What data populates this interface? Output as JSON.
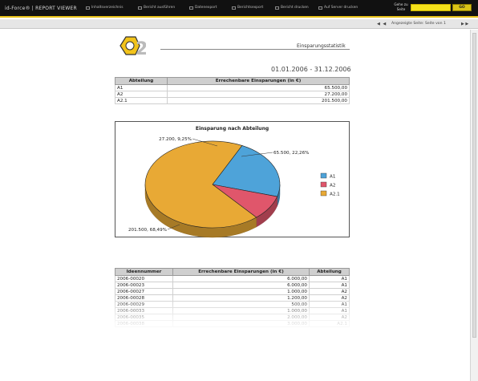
{
  "toolbar": {
    "brand": "id-Force® | REPORT VIEWER",
    "items": [
      "Inhaltsverzeichnis",
      "Bericht ausführen",
      "Datenexport",
      "Berichtsexport",
      "Bericht drucken",
      "Auf Server drucken"
    ],
    "goto_label": "Gehe zu Seite",
    "goto_value": "",
    "go_label": "GO"
  },
  "nav": {
    "prev_arrows": "◀ ◀",
    "page_text": "Angezeigte Seite:  Seite    von  1",
    "next_arrows": "▶ ▶"
  },
  "report": {
    "logo_text": "2",
    "title": "Einsparungsstatistik",
    "date_range": "01.01.2006 - 31.12.2006"
  },
  "summary_table": {
    "headers": [
      "Abteilung",
      "Errechenbare Einsparungen (in €)"
    ],
    "rows": [
      [
        "A1",
        "65.500,00"
      ],
      [
        "A2",
        "27.200,00"
      ],
      [
        "A2.1",
        "201.500,00"
      ]
    ]
  },
  "chart_data": {
    "type": "pie",
    "title": "Einsparung nach Abteilung",
    "categories": [
      "A1",
      "A2",
      "A2.1"
    ],
    "values": [
      65500,
      27200,
      201500
    ],
    "data_labels": [
      "65.500, 22,26%",
      "27.200, 9,25%",
      "201.500, 68,49%"
    ],
    "colors": [
      "#4ea3d9",
      "#e0566b",
      "#e8a935"
    ],
    "legend": "right",
    "3d": true
  },
  "detail_table": {
    "headers": [
      "Ideennummer",
      "Errechenbare Einsparungen (in €)",
      "Abteilung"
    ],
    "rows": [
      [
        "2006-00020",
        "6.000,00",
        "A1"
      ],
      [
        "2006-00023",
        "6.000,00",
        "A1"
      ],
      [
        "2006-00027",
        "1.000,00",
        "A2"
      ],
      [
        "2006-00028",
        "1.200,00",
        "A2"
      ],
      [
        "2006-00029",
        "500,00",
        "A1"
      ],
      [
        "2006-00033",
        "1.000,00",
        "A1"
      ],
      [
        "2006-00035",
        "2.000,00",
        "A2"
      ],
      [
        "2006-00038",
        "3.000,00",
        "A2.1"
      ]
    ]
  }
}
